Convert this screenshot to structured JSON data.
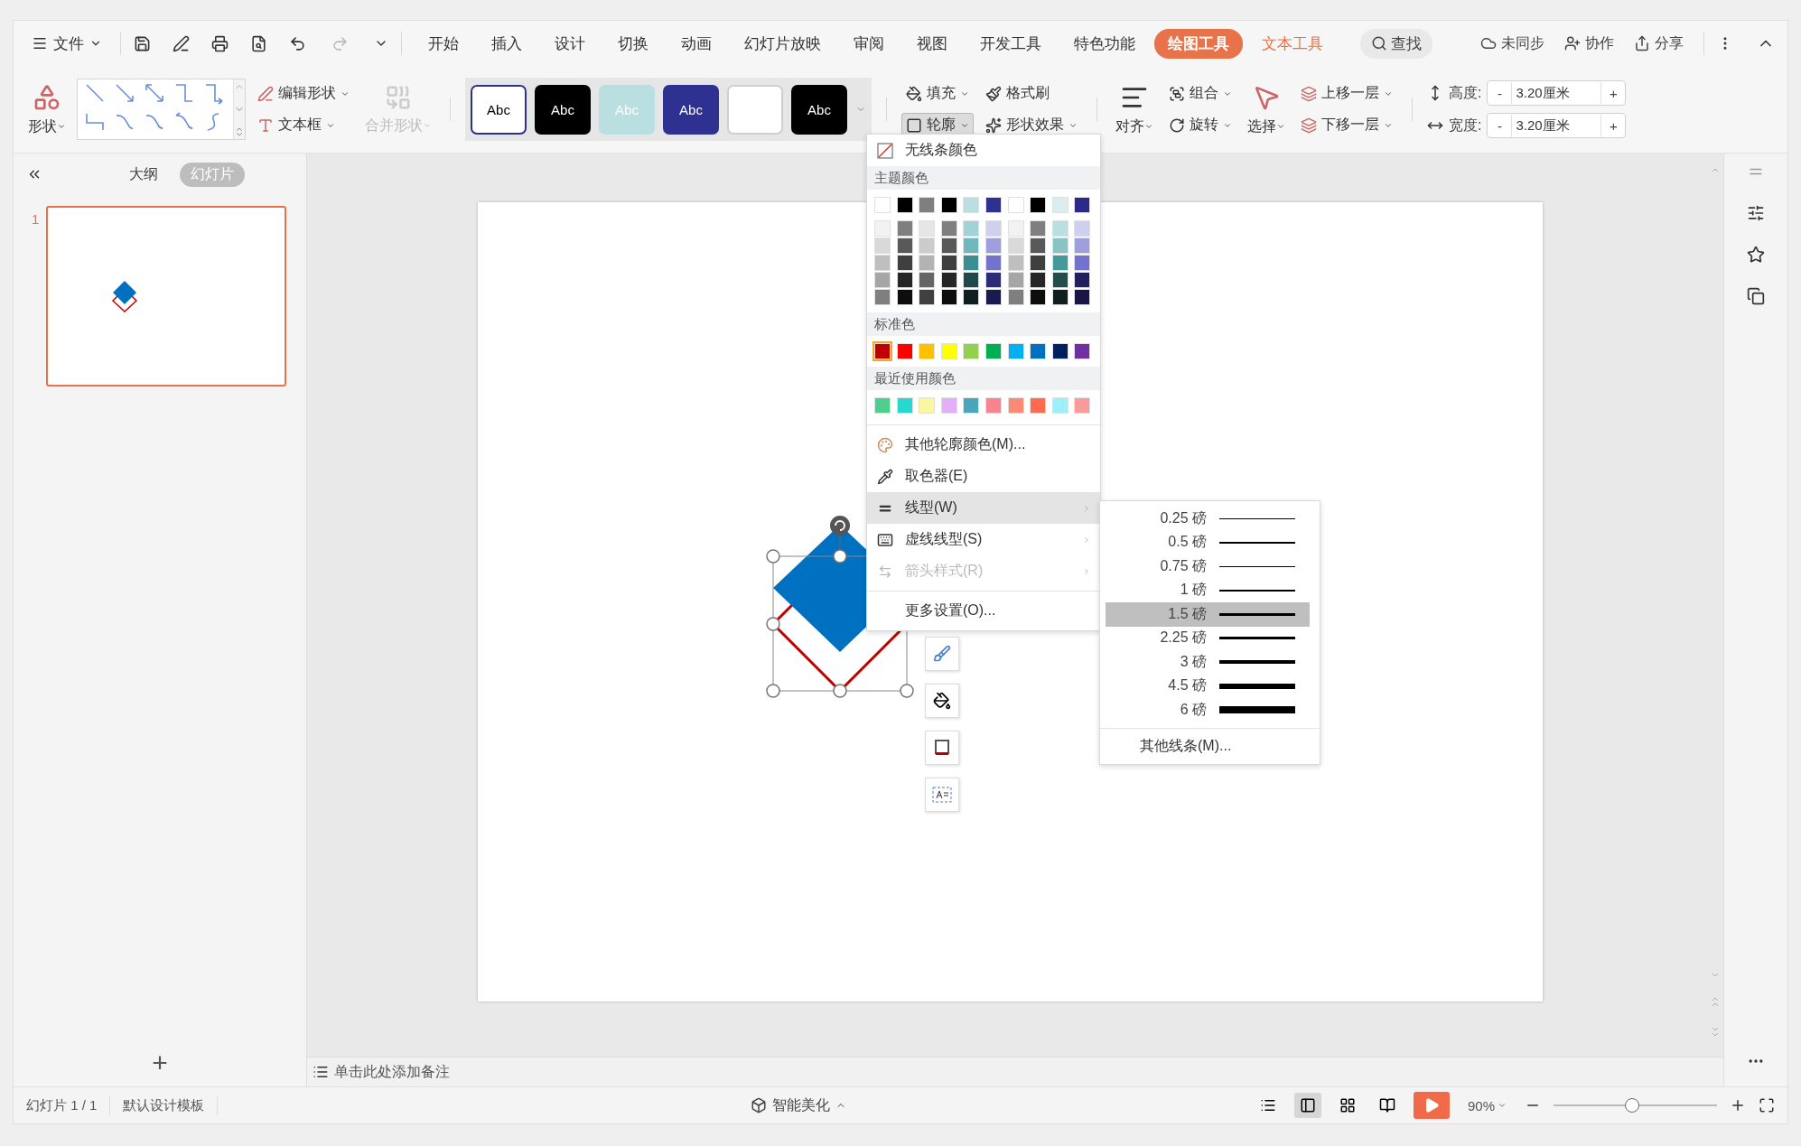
{
  "menu_bar": {
    "file_menu": "文件",
    "tabs": [
      {
        "label": "开始",
        "selected": false,
        "kind": "normal"
      },
      {
        "label": "插入",
        "selected": false,
        "kind": "normal"
      },
      {
        "label": "设计",
        "selected": false,
        "kind": "normal"
      },
      {
        "label": "切换",
        "selected": false,
        "kind": "normal"
      },
      {
        "label": "动画",
        "selected": false,
        "kind": "normal"
      },
      {
        "label": "幻灯片放映",
        "selected": false,
        "kind": "normal"
      },
      {
        "label": "审阅",
        "selected": false,
        "kind": "normal"
      },
      {
        "label": "视图",
        "selected": false,
        "kind": "normal"
      },
      {
        "label": "开发工具",
        "selected": false,
        "kind": "normal"
      },
      {
        "label": "特色功能",
        "selected": false,
        "kind": "normal"
      },
      {
        "label": "绘图工具",
        "selected": true,
        "kind": "context"
      },
      {
        "label": "文本工具",
        "selected": false,
        "kind": "context"
      }
    ],
    "search": "查找",
    "actions": [
      {
        "label": "未同步",
        "kind": "sync"
      },
      {
        "label": "协作",
        "kind": "collab"
      },
      {
        "label": "分享",
        "kind": "share"
      }
    ]
  },
  "ribbon": {
    "shapes": "形状",
    "edit_shape": "编辑形状",
    "text_box": "文本框",
    "merge_shapes": {
      "label": "合并形状",
      "disabled": true
    },
    "styles": [
      {
        "kind": "outline",
        "color": "#2e3192",
        "label": "Abc"
      },
      {
        "kind": "fill",
        "color": "#000000",
        "label": "Abc"
      },
      {
        "kind": "fill",
        "color": "#b9dfe0",
        "label": "Abc"
      },
      {
        "kind": "fill",
        "color": "#2e3192",
        "label": "Abc"
      },
      {
        "kind": "blank",
        "color": "#ffffff"
      },
      {
        "kind": "fill",
        "color": "#000000",
        "label": "Abc"
      }
    ],
    "fill": "填充",
    "format_painter": "格式刷",
    "outline": {
      "label": "轮廓",
      "expanded": true
    },
    "shape_effects": "形状效果",
    "align": "对齐",
    "group": "组合",
    "rotate": "旋转",
    "select": "选择",
    "bring_forward": "上移一层",
    "send_backward": "下移一层",
    "height": {
      "label": "高度:",
      "value": "3.20厘米",
      "decrement": "-",
      "increment": "+"
    },
    "width": {
      "label": "宽度:",
      "value": "3.20厘米",
      "decrement": "-",
      "increment": "+"
    }
  },
  "panel": {
    "tabs": [
      {
        "label": "大纲",
        "selected": false
      },
      {
        "label": "幻灯片",
        "selected": true
      }
    ],
    "slides": [
      {
        "number": "1",
        "selected": true
      }
    ],
    "add": "+"
  },
  "notes": {
    "prompt": "单击此处添加备注"
  },
  "status_bar": {
    "slide_count": "幻灯片 1 / 1",
    "template": "默认设计模板",
    "beautify": "智能美化",
    "views": [
      {
        "kind": "notes",
        "selected": false
      },
      {
        "kind": "normal",
        "selected": true
      },
      {
        "kind": "sorter",
        "selected": false
      },
      {
        "kind": "reading",
        "selected": false
      }
    ],
    "zoom": "90%",
    "zoom_slider": {
      "level": 0.48
    }
  },
  "outline_menu": {
    "no_color": "无线条颜色",
    "theme_title": "主题颜色",
    "theme_top": [
      {
        "color": "#ffffff"
      },
      {
        "color": "#000000"
      },
      {
        "color": "#7f7f7f"
      },
      {
        "color": "#000000"
      },
      {
        "color": "#b9dfe0"
      },
      {
        "color": "#2e3192"
      },
      {
        "color": "#ffffff"
      },
      {
        "color": "#000000"
      },
      {
        "color": "#d9ecee"
      },
      {
        "color": "#2b2a8a"
      }
    ],
    "theme_shades": [
      {
        "color": "#f2f2f2"
      },
      {
        "color": "#7f7f7f"
      },
      {
        "color": "#e6e6e6"
      },
      {
        "color": "#7f7f7f"
      },
      {
        "color": "#9fd3d5"
      },
      {
        "color": "#cfcfee"
      },
      {
        "color": "#f2f2f2"
      },
      {
        "color": "#7f7f7f"
      },
      {
        "color": "#b9dfe0"
      },
      {
        "color": "#cfcfee"
      },
      {
        "color": "#d9d9d9"
      },
      {
        "color": "#595959"
      },
      {
        "color": "#cccccc"
      },
      {
        "color": "#595959"
      },
      {
        "color": "#6fb9bd"
      },
      {
        "color": "#a09fdd"
      },
      {
        "color": "#d9d9d9"
      },
      {
        "color": "#595959"
      },
      {
        "color": "#88c3c5"
      },
      {
        "color": "#a09fdd"
      },
      {
        "color": "#bfbfbf"
      },
      {
        "color": "#3f3f3f"
      },
      {
        "color": "#b3b3b3"
      },
      {
        "color": "#3f3f3f"
      },
      {
        "color": "#3b8f92"
      },
      {
        "color": "#7372cc"
      },
      {
        "color": "#bfbfbf"
      },
      {
        "color": "#3f3f3f"
      },
      {
        "color": "#44999b"
      },
      {
        "color": "#7372cc"
      },
      {
        "color": "#a6a6a6"
      },
      {
        "color": "#262626"
      },
      {
        "color": "#666666"
      },
      {
        "color": "#262626"
      },
      {
        "color": "#1f4a4c"
      },
      {
        "color": "#2e2a7a"
      },
      {
        "color": "#a6a6a6"
      },
      {
        "color": "#262626"
      },
      {
        "color": "#234c4d"
      },
      {
        "color": "#23205e"
      },
      {
        "color": "#7f7f7f"
      },
      {
        "color": "#0d0d0d"
      },
      {
        "color": "#404040"
      },
      {
        "color": "#0d0d0d"
      },
      {
        "color": "#0f1f20"
      },
      {
        "color": "#1a1950"
      },
      {
        "color": "#7f7f7f"
      },
      {
        "color": "#0d0d0d"
      },
      {
        "color": "#0f1f20"
      },
      {
        "color": "#171646"
      }
    ],
    "standard_title": "标准色",
    "standard": [
      {
        "color": "#c00000",
        "selected": true
      },
      {
        "color": "#ff0000",
        "selected": false
      },
      {
        "color": "#ffc000",
        "selected": false
      },
      {
        "color": "#ffff00",
        "selected": false
      },
      {
        "color": "#92d050",
        "selected": false
      },
      {
        "color": "#00b050",
        "selected": false
      },
      {
        "color": "#00b0f0",
        "selected": false
      },
      {
        "color": "#0070c0",
        "selected": false
      },
      {
        "color": "#002060",
        "selected": false
      },
      {
        "color": "#7030a0",
        "selected": false
      }
    ],
    "recent_title": "最近使用颜色",
    "recent": [
      {
        "color": "#4fce8e"
      },
      {
        "color": "#27d8cc"
      },
      {
        "color": "#faf7a0"
      },
      {
        "color": "#e2b0f8"
      },
      {
        "color": "#4aa6bb"
      },
      {
        "color": "#f98490"
      },
      {
        "color": "#fb8a74"
      },
      {
        "color": "#ff6b4e"
      },
      {
        "color": "#9ef0f8"
      },
      {
        "color": "#f99b9b"
      }
    ],
    "items": [
      {
        "label": "其他轮廓颜色(M)...",
        "kind": "palette",
        "selected": false,
        "disabled": false,
        "submenu": false
      },
      {
        "label": "取色器(E)",
        "kind": "picker",
        "selected": false,
        "disabled": false,
        "submenu": false
      },
      {
        "label": "线型(W)",
        "kind": "lines",
        "selected": true,
        "disabled": false,
        "submenu": true
      },
      {
        "label": "虚线线型(S)",
        "kind": "dash",
        "selected": false,
        "disabled": false,
        "submenu": true
      },
      {
        "label": "箭头样式(R)",
        "kind": "arrow",
        "selected": false,
        "disabled": true,
        "submenu": true
      },
      {
        "label": "更多设置(O)...",
        "kind": "more",
        "selected": false,
        "disabled": false,
        "submenu": false
      }
    ]
  },
  "line_weight_menu": {
    "items": [
      {
        "label": "0.25 磅",
        "selected": false
      },
      {
        "label": "0.5 磅",
        "selected": false
      },
      {
        "label": "0.75 磅",
        "selected": false
      },
      {
        "label": "1 磅",
        "selected": false
      },
      {
        "label": "1.5 磅",
        "selected": true
      },
      {
        "label": "2.25 磅",
        "selected": false
      },
      {
        "label": "3 磅",
        "selected": false
      },
      {
        "label": "4.5 磅",
        "selected": false
      },
      {
        "label": "6 磅",
        "selected": false
      }
    ],
    "more": "其他线条(M)..."
  }
}
